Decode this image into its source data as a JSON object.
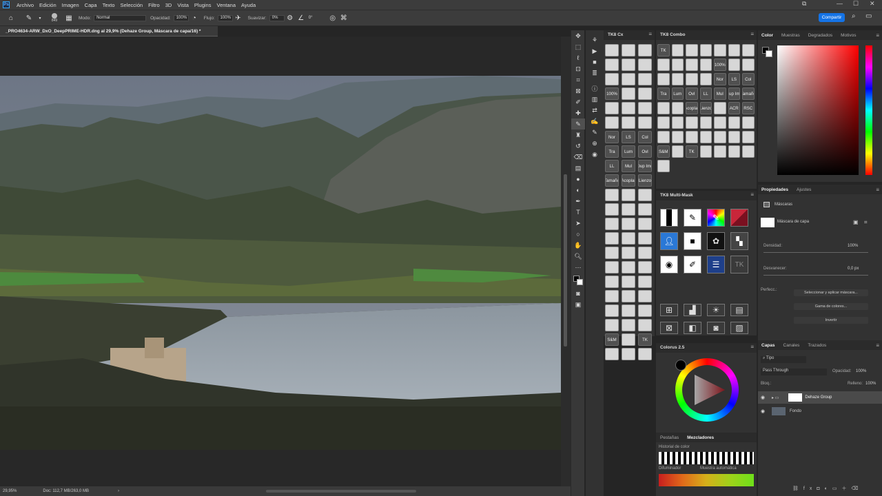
{
  "menubar": {
    "items": [
      "Archivo",
      "Edición",
      "Imagen",
      "Capa",
      "Texto",
      "Selección",
      "Filtro",
      "3D",
      "Vista",
      "Plugins",
      "Ventana",
      "Ayuda"
    ]
  },
  "options": {
    "size": "849",
    "mode_label": "Modo:",
    "mode_value": "Normal",
    "opacity_label": "Opacidad:",
    "opacity_value": "100%",
    "flow_label": "Flujo:",
    "flow_value": "100%",
    "smooth_label": "Suavizar:",
    "smooth_value": "0%",
    "angle_value": "0°",
    "share_label": "Compartir"
  },
  "document": {
    "tab_title": "_PRO4634-ARW_DxO_DeepPRIME-HDR.dng al 29,9% (Dehaze Group, Máscara de capa/16) *",
    "zoom": "29,95%",
    "doc_info": "Doc: 112,7 MB/263,0 MB"
  },
  "tk8cx": {
    "title": "TK8 Cx",
    "buttons": [
      "",
      "",
      "",
      "",
      "",
      "",
      "",
      "",
      "",
      "100%",
      "",
      "",
      "",
      "",
      "",
      "",
      "",
      "",
      "Nor",
      "LS",
      "Col",
      "Tra",
      "Lum",
      "Ovl",
      "LL",
      "Mul",
      "Dup Img",
      "Tamaño",
      "Acoplar",
      "Lienzo",
      "",
      "",
      "",
      "",
      "",
      "",
      "",
      "",
      "",
      "",
      "",
      "",
      "",
      "",
      "",
      "",
      "",
      "",
      "",
      "",
      "",
      "",
      "",
      "",
      "",
      "",
      "",
      "",
      "",
      "",
      "S&M",
      "",
      "TK",
      "",
      "",
      ""
    ]
  },
  "tk8combo": {
    "title": "TK8 Combo",
    "buttons": [
      "TK",
      "",
      "",
      "",
      "",
      "",
      "",
      "",
      "",
      "",
      "",
      "100%",
      "",
      "",
      "",
      "",
      "",
      "",
      "Nor",
      "LS",
      "Col",
      "Tra",
      "Lum",
      "Ovl",
      "LL",
      "Mul",
      "Dup Img",
      "Tamaño",
      "",
      "",
      "Acoplar",
      "Lienzo",
      "",
      "ACR",
      "RSC",
      "",
      "",
      "",
      "",
      "",
      "",
      "",
      "",
      "",
      "",
      "",
      "",
      "",
      "",
      "S&M",
      "",
      "TK",
      "",
      "",
      "",
      "",
      ""
    ]
  },
  "multimask": {
    "title": "TK8 Multi-Mask",
    "tk_label": "TK"
  },
  "colorus": {
    "title": "Colorus 2.5",
    "tab_swatches": "Pestañas",
    "tab_mixers": "Mezcladores",
    "history_label": "Historial de color",
    "blur_label": "Difuminador",
    "sample_label": "Muestra automática"
  },
  "color_panel": {
    "tabs": [
      "Color",
      "Muestras",
      "Degradados",
      "Motivos"
    ]
  },
  "properties": {
    "tabs": [
      "Propiedades",
      "Ajustes"
    ],
    "section": "Máscaras",
    "mask_label": "Máscara de capa",
    "density_label": "Densidad:",
    "density_value": "100%",
    "feather_label": "Desvanecer:",
    "feather_value": "0,0 px",
    "refine_label": "Perfecc.:",
    "select_mask_btn": "Seleccionar y aplicar máscara...",
    "color_range_btn": "Gama de colores...",
    "invert_btn": "Invertir"
  },
  "layers": {
    "tabs": [
      "Capas",
      "Canales",
      "Trazados"
    ],
    "filter_label": "Tipo",
    "blend_mode": "Pass Through",
    "opacity_label": "Opacidad:",
    "opacity_value": "100%",
    "lock_label": "Bloq.:",
    "fill_label": "Relleno:",
    "fill_value": "100%",
    "items": [
      {
        "name": "Dehaze Group"
      },
      {
        "name": "Fondo"
      }
    ]
  }
}
